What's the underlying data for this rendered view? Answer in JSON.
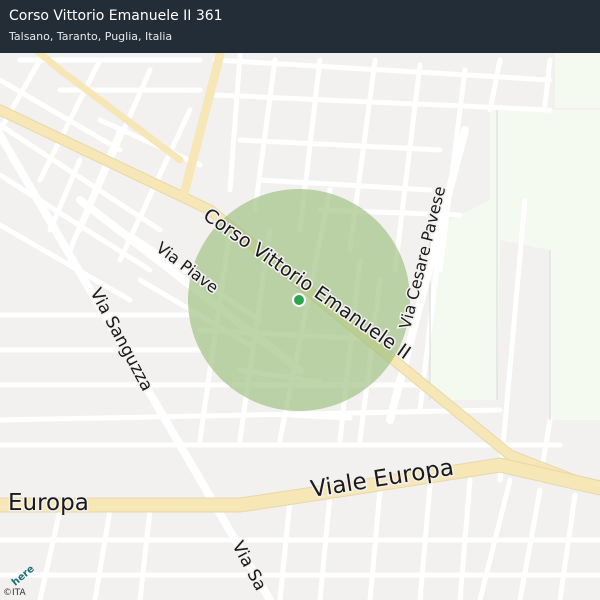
{
  "header": {
    "title": "Corso Vittorio Emanuele II 361",
    "subtitle": "Talsano, Taranto, Puglia, Italia"
  },
  "map": {
    "street_labels": [
      {
        "id": "corso",
        "text": "Corso Vittorio Emanuele II"
      },
      {
        "id": "piave",
        "text": "Via Piave"
      },
      {
        "id": "cesare",
        "text": "Via Cesare Pavese"
      },
      {
        "id": "sanguzza",
        "text": "Via Sanguzza"
      },
      {
        "id": "sanguzza2",
        "text": "Via Sa"
      },
      {
        "id": "europa",
        "text": "Viale  Europa"
      },
      {
        "id": "europa2",
        "text": "Europa"
      }
    ],
    "marker_color": "#2ea44f",
    "radius_color": "#9bbf7c",
    "park_color": "#f4faef",
    "road_major_color": "#f7e7b7"
  },
  "footer": {
    "logo_text": "here",
    "attribution": "©ITA"
  }
}
